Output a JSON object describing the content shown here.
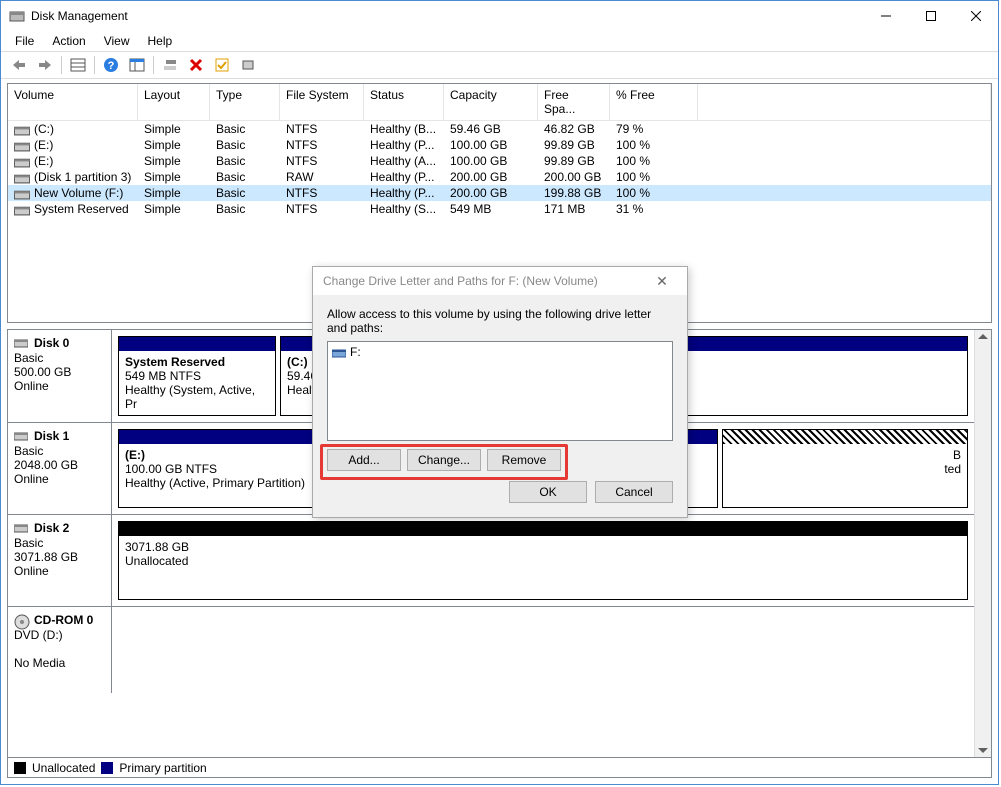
{
  "window": {
    "title": "Disk Management"
  },
  "menu": {
    "file": "File",
    "action": "Action",
    "view": "View",
    "help": "Help"
  },
  "columns": [
    "Volume",
    "Layout",
    "Type",
    "File System",
    "Status",
    "Capacity",
    "Free Spa...",
    "% Free"
  ],
  "volumes": [
    {
      "name": "(C:)",
      "layout": "Simple",
      "type": "Basic",
      "fs": "NTFS",
      "status": "Healthy (B...",
      "cap": "59.46 GB",
      "free": "46.82 GB",
      "pct": "79 %",
      "sel": false
    },
    {
      "name": "(E:)",
      "layout": "Simple",
      "type": "Basic",
      "fs": "NTFS",
      "status": "Healthy (P...",
      "cap": "100.00 GB",
      "free": "99.89 GB",
      "pct": "100 %",
      "sel": false
    },
    {
      "name": "(E:)",
      "layout": "Simple",
      "type": "Basic",
      "fs": "NTFS",
      "status": "Healthy (A...",
      "cap": "100.00 GB",
      "free": "99.89 GB",
      "pct": "100 %",
      "sel": false
    },
    {
      "name": "(Disk 1 partition 3)",
      "layout": "Simple",
      "type": "Basic",
      "fs": "RAW",
      "status": "Healthy (P...",
      "cap": "200.00 GB",
      "free": "200.00 GB",
      "pct": "100 %",
      "sel": false
    },
    {
      "name": "New Volume (F:)",
      "layout": "Simple",
      "type": "Basic",
      "fs": "NTFS",
      "status": "Healthy (P...",
      "cap": "200.00 GB",
      "free": "199.88 GB",
      "pct": "100 %",
      "sel": true
    },
    {
      "name": "System Reserved",
      "layout": "Simple",
      "type": "Basic",
      "fs": "NTFS",
      "status": "Healthy (S...",
      "cap": "549 MB",
      "free": "171 MB",
      "pct": "31 %",
      "sel": false
    }
  ],
  "disks": {
    "d0": {
      "name": "Disk 0",
      "type": "Basic",
      "size": "500.00 GB",
      "status": "Online",
      "p0": {
        "label": "System Reserved",
        "line2": "549 MB NTFS",
        "line3": "Healthy (System, Active, Pr"
      },
      "p1": {
        "label": "(C:)",
        "line2": "59.46 G",
        "line3": "Health"
      }
    },
    "d1": {
      "name": "Disk 1",
      "type": "Basic",
      "size": "2048.00 GB",
      "status": "Online",
      "p0": {
        "label": "(E:)",
        "line2": "100.00 GB NTFS",
        "line3": "Healthy (Active, Primary Partition)"
      },
      "p1": {
        "line2": "B",
        "line3": "ted"
      }
    },
    "d2": {
      "name": "Disk 2",
      "type": "Basic",
      "size": "3071.88 GB",
      "status": "Online",
      "p0": {
        "label": "",
        "line2": "3071.88 GB",
        "line3": "Unallocated"
      }
    },
    "cd": {
      "name": "CD-ROM 0",
      "type": "DVD (D:)",
      "status": "No Media"
    }
  },
  "legend": {
    "unalloc": "Unallocated",
    "primary": "Primary partition"
  },
  "dialog": {
    "title": "Change Drive Letter and Paths for F: (New Volume)",
    "instruction": "Allow access to this volume by using the following drive letter and paths:",
    "item": "F:",
    "add": "Add...",
    "change": "Change...",
    "remove": "Remove",
    "ok": "OK",
    "cancel": "Cancel"
  }
}
